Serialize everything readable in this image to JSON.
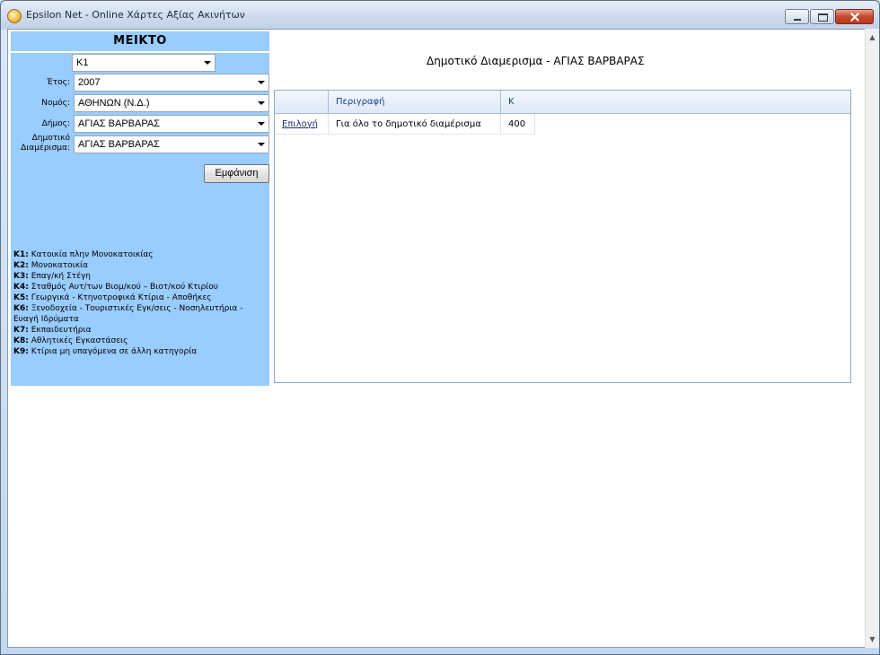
{
  "window": {
    "title": "Epsilon Net - Online Χάρτες Αξίας Ακινήτων"
  },
  "left_panel": {
    "title": "ΜΕΙΚΤΟ",
    "category_select": {
      "value": "Κ1"
    },
    "fields": [
      {
        "label": "Έτος:",
        "value": "2007"
      },
      {
        "label": "Νομός:",
        "value": "ΑΘΗΝΩΝ (Ν.Δ.)"
      },
      {
        "label": "Δήμος:",
        "value": "ΑΓΙΑΣ ΒΑΡΒΑΡΑΣ"
      },
      {
        "label_line1": "Δημοτικό",
        "label_line2": "Διαμέρισμα:",
        "value": "ΑΓΙΑΣ ΒΑΡΒΑΡΑΣ"
      }
    ],
    "show_button": "Εμφάνιση",
    "legend": [
      {
        "code": "Κ1:",
        "text": "Κατοικία πλην Μονοκατοικίας"
      },
      {
        "code": "Κ2:",
        "text": "Μονοκατοικία"
      },
      {
        "code": "Κ3:",
        "text": "Επαγ/κή Στέγη"
      },
      {
        "code": "Κ4:",
        "text": "Σταθμός Αυτ/των Βιομ/κού – Βιοτ/κού Κτιρίου"
      },
      {
        "code": "Κ5:",
        "text": "Γεωργικά - Κτηνοτροφικά Κτίρια - Αποθήκες"
      },
      {
        "code": "Κ6:",
        "text": "Ξενοδοχεία - Τουριστικές Εγκ/σεις - Νοσηλευτήρια - Ευαγή Ιδρύματα"
      },
      {
        "code": "Κ7:",
        "text": "Εκπαιδευτήρια"
      },
      {
        "code": "Κ8:",
        "text": "Αθλητικές Εγκαστάσεις"
      },
      {
        "code": "Κ9:",
        "text": "Κτίρια μη υπαγόμενα σε άλλη κατηγορία"
      }
    ]
  },
  "content": {
    "heading": "Δημοτικό Διαμερισμα - ΑΓΙΑΣ ΒΑΡΒΑΡΑΣ",
    "table": {
      "columns": [
        "",
        "Περιγραφή",
        "Κ"
      ],
      "rows": [
        {
          "select_link": "Επιλογή",
          "description": "Για όλο το δημοτικό διαμέρισμα",
          "k": "400"
        }
      ]
    }
  },
  "colors": {
    "panel_bg": "#99ccff",
    "header_text": "#1b3f8a"
  }
}
